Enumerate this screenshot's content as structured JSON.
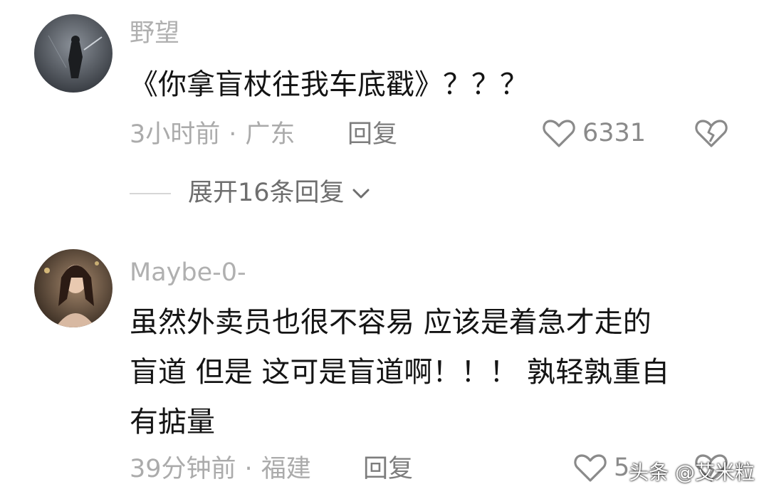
{
  "comments": [
    {
      "username": "野望",
      "text": "《你拿盲杖往我车底戳》？？？",
      "time": "3小时前",
      "separator": "·",
      "location": "广东",
      "reply_label": "回复",
      "like_count": "6331"
    },
    {
      "username": "Maybe-0-",
      "text_lines": [
        "虽然外卖员也很不容易 应该是着急才走的",
        "盲道 但是  这可是盲道啊！！！ 孰轻孰重自",
        "有掂量"
      ],
      "time": "39分钟前",
      "separator": "·",
      "location": "福建",
      "reply_label": "回复",
      "like_count": "5"
    }
  ],
  "expand_replies_label": "展开16条回复",
  "watermark": "头条 @艾米粒",
  "icons": {
    "like": "heart-outline-icon",
    "dislike": "broken-heart-icon",
    "expand": "chevron-down-icon"
  },
  "colors": {
    "text_primary": "#141414",
    "text_secondary": "#ababab",
    "background": "#ffffff"
  }
}
